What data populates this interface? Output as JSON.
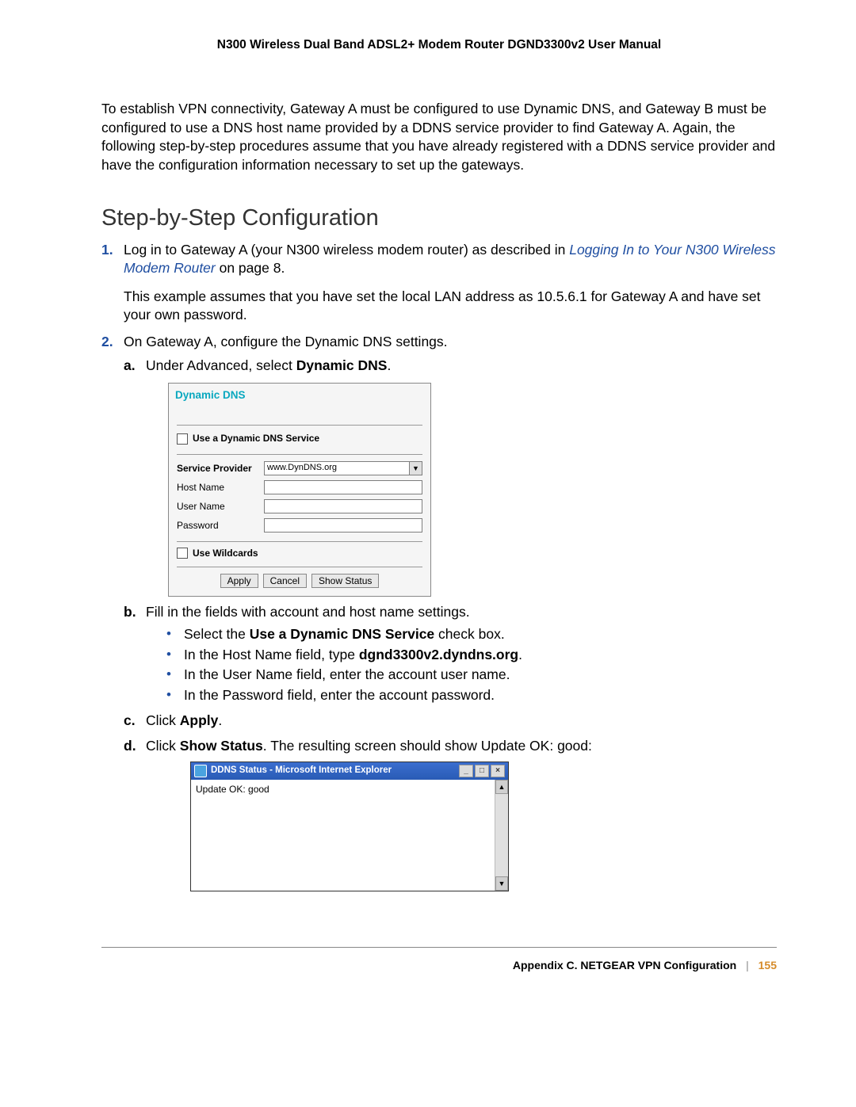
{
  "header": "N300 Wireless Dual Band ADSL2+ Modem Router DGND3300v2 User Manual",
  "intro": "To establish VPN connectivity, Gateway A must be configured to use Dynamic DNS, and Gateway B must be configured to use a DNS host name provided by a DDNS service provider to find Gateway A. Again, the following step-by-step procedures assume that you have already registered with a DDNS service provider and have the configuration information necessary to set up the gateways.",
  "section_heading": "Step-by-Step Configuration",
  "steps": {
    "one_num": "1.",
    "one_a": "Log in to Gateway A (your N300 wireless modem router) as described in ",
    "one_link": "Logging In to Your N300 Wireless Modem Router ",
    "one_b": "on page 8.",
    "one_sub": "This example assumes that you have set the local LAN address as 10.5.6.1 for Gateway A and have set your own password.",
    "two_num": "2.",
    "two": "On Gateway A, configure the Dynamic DNS settings."
  },
  "sub": {
    "a_num": "a.",
    "a_pre": "Under Advanced, select ",
    "a_bold": "Dynamic DNS",
    "a_post": ".",
    "b_num": "b.",
    "b": "Fill in the fields with account and host name settings.",
    "c_num": "c.",
    "c_pre": "Click ",
    "c_bold": "Apply",
    "c_post": ".",
    "d_num": "d.",
    "d_pre": "Click ",
    "d_bold": "Show Status",
    "d_post": ". The resulting screen should show Update OK: good:"
  },
  "bullets": {
    "b1_pre": "Select the ",
    "b1_bold": "Use a Dynamic DNS Service",
    "b1_post": " check box.",
    "b2_pre": "In the Host Name field, type ",
    "b2_bold": "dgnd3300v2.dyndns.org",
    "b2_post": ".",
    "b3": "In the User Name field, enter the account user name.",
    "b4": "In the Password field, enter the account password."
  },
  "ddns": {
    "title": "Dynamic DNS",
    "use_service": "Use a Dynamic DNS Service",
    "service_provider": "Service Provider",
    "provider_value": "www.DynDNS.org",
    "host_name": "Host Name",
    "user_name": "User Name",
    "password": "Password",
    "use_wildcards": "Use Wildcards",
    "apply": "Apply",
    "cancel": "Cancel",
    "show_status": "Show Status"
  },
  "ie": {
    "title": "DDNS Status - Microsoft Internet Explorer",
    "body": "Update OK: good"
  },
  "footer": {
    "appendix": "Appendix C.  NETGEAR VPN Configuration",
    "page": "155"
  }
}
